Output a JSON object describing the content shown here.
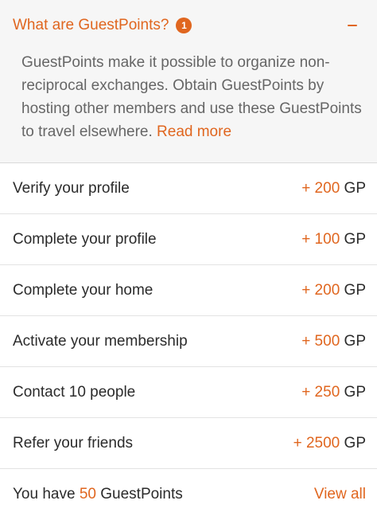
{
  "faq": {
    "title": "What are GuestPoints?",
    "badge": "1",
    "toggle_icon": "minus-icon",
    "body": "GuestPoints make it possible to organize non-reciprocal exchanges. Obtain GuestPoints by hosting other members and use these GuestPoints to travel elsewhere.",
    "read_more": "Read more"
  },
  "tasks": [
    {
      "label": "Verify your profile",
      "amount": "+ 200",
      "unit": "GP"
    },
    {
      "label": "Complete your profile",
      "amount": "+ 100",
      "unit": "GP"
    },
    {
      "label": "Complete your home",
      "amount": "+ 200",
      "unit": "GP"
    },
    {
      "label": "Activate your membership",
      "amount": "+ 500",
      "unit": "GP"
    },
    {
      "label": "Contact 10 people",
      "amount": "+ 250",
      "unit": "GP"
    },
    {
      "label": "Refer your friends",
      "amount": "+ 2500",
      "unit": "GP"
    }
  ],
  "footer": {
    "prefix": "You have",
    "balance": "50",
    "suffix": "GuestPoints",
    "view_all": "View all"
  },
  "colors": {
    "accent": "#e0661f",
    "panel_bg": "#f6f6f6",
    "text": "#2b2b2b",
    "muted_text": "#666666"
  }
}
